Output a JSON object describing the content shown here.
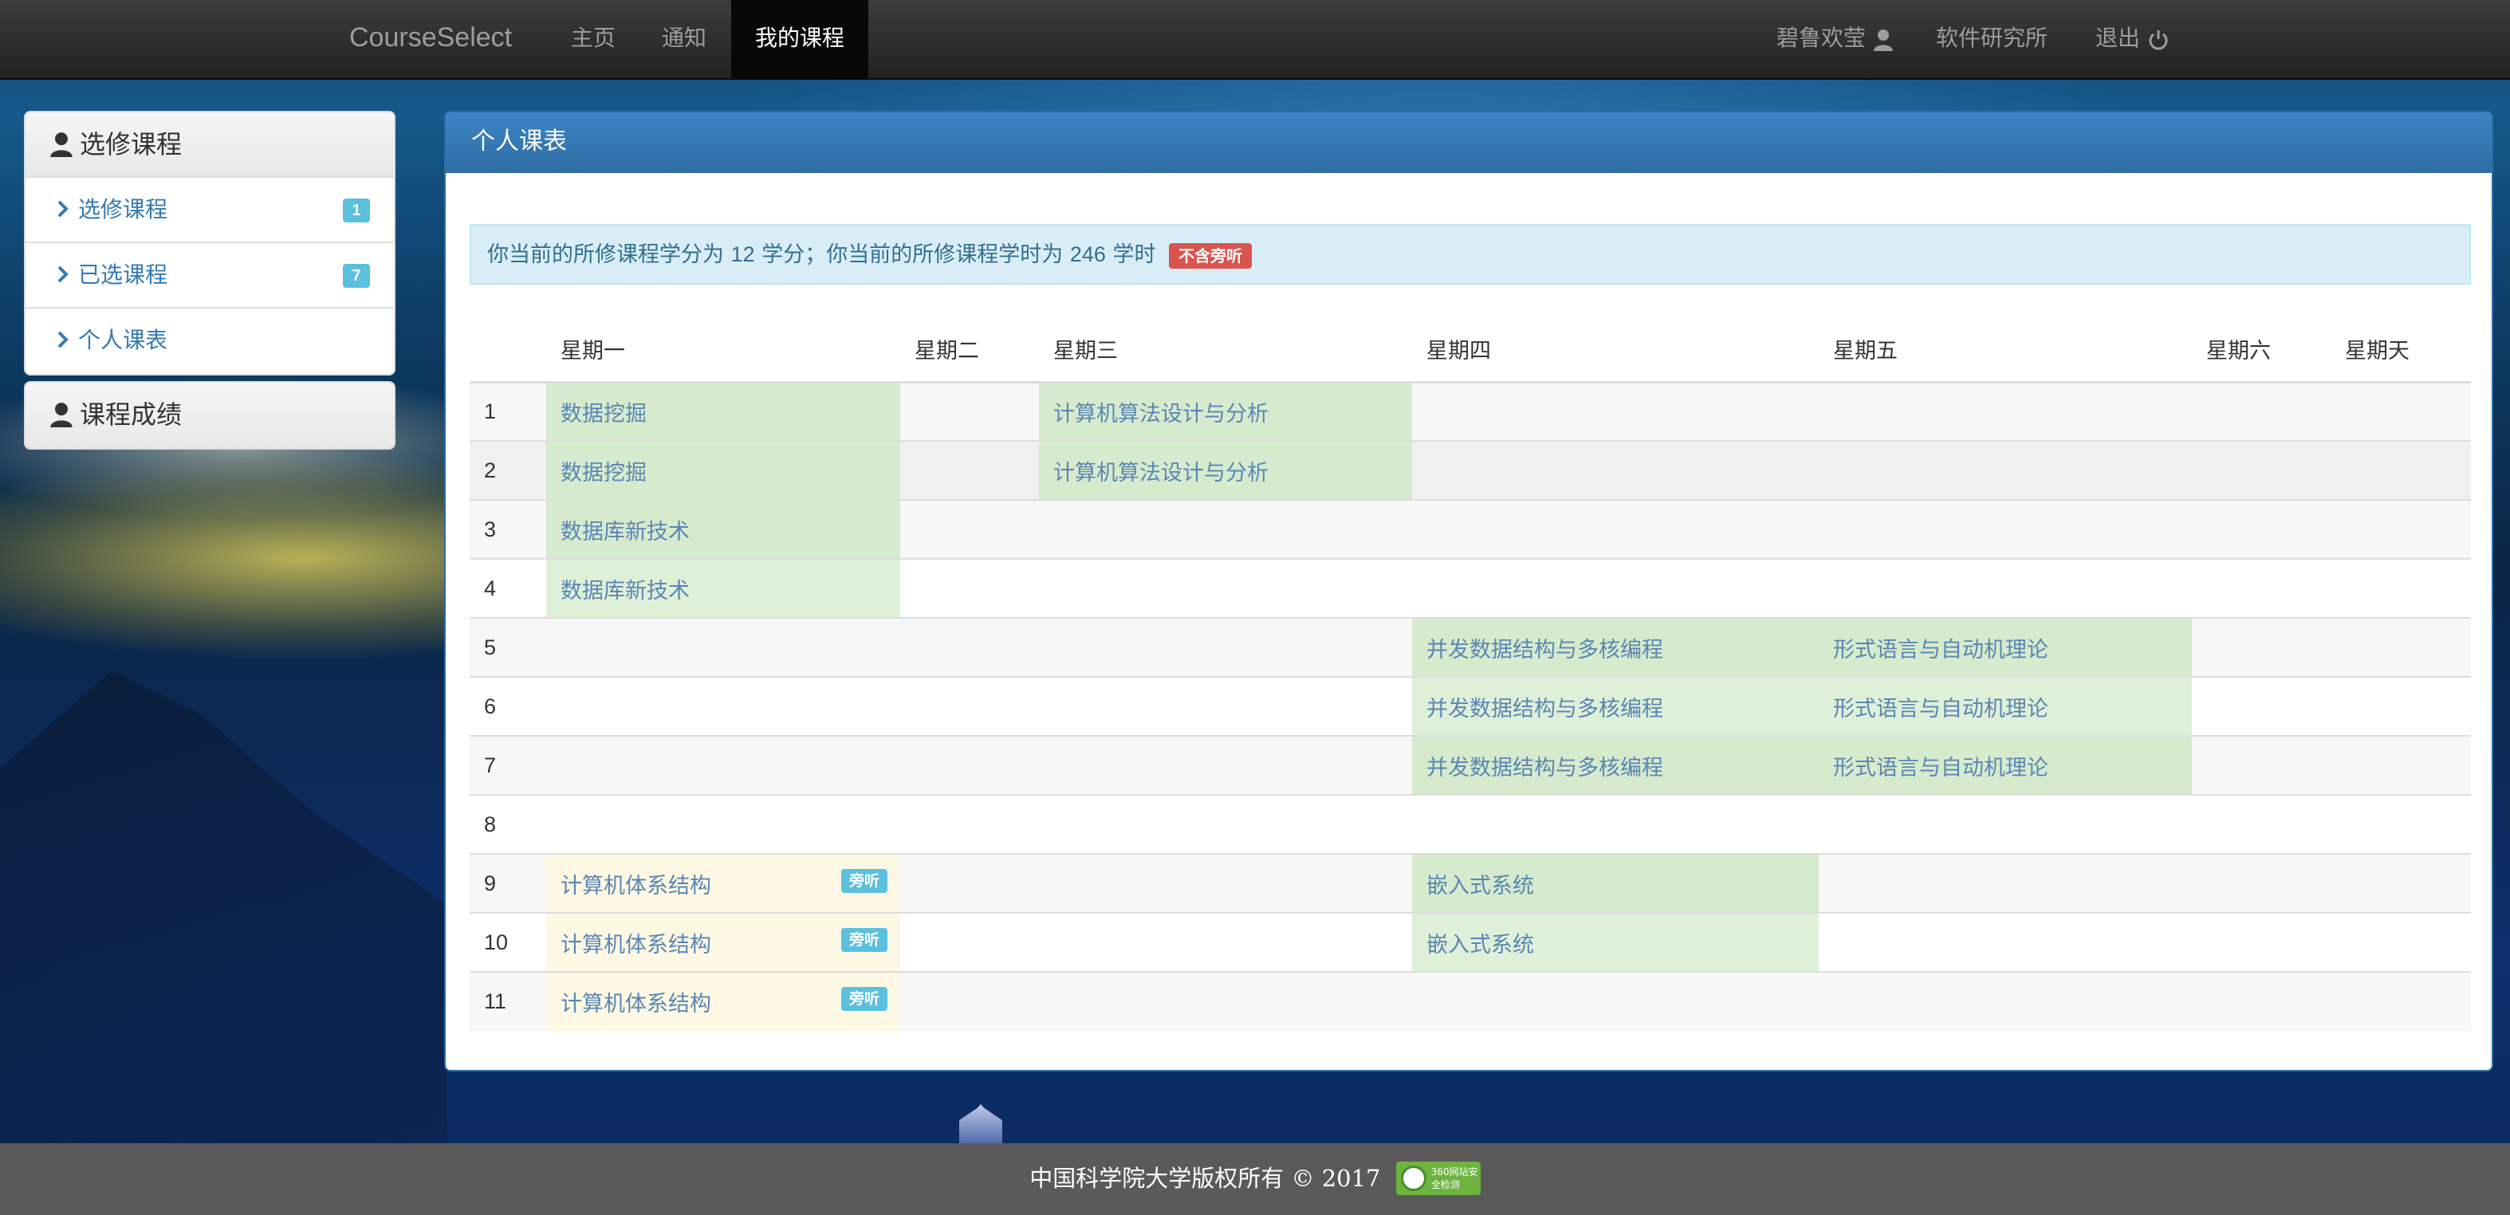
{
  "navbar": {
    "brand": "CourseSelect",
    "links": [
      "主页",
      "通知",
      "我的课程"
    ],
    "active_link": "我的课程",
    "user": "碧鲁欢莹",
    "dept": "软件研究所",
    "logout": "退出"
  },
  "sidebar": {
    "panel1_title": "选修课程",
    "items": [
      {
        "label": "选修课程",
        "badge": "1"
      },
      {
        "label": "已选课程",
        "badge": "7"
      },
      {
        "label": "个人课表",
        "badge": ""
      }
    ],
    "panel2_title": "课程成绩"
  },
  "main": {
    "title": "个人课表",
    "alert": {
      "prefix": "你当前的所修课程学分为",
      "credits": "12",
      "mid": "学分；你当前的所修课程学时为",
      "hours": "246",
      "suffix": "学时",
      "tag": "不含旁听"
    },
    "days": [
      "星期一",
      "星期二",
      "星期三",
      "星期四",
      "星期五",
      "星期六",
      "星期天"
    ],
    "audit_label": "旁听",
    "rows": [
      {
        "idx": "1",
        "mon": "数据挖掘",
        "wed": "计算机算法设计与分析"
      },
      {
        "idx": "2",
        "mon": "数据挖掘",
        "wed": "计算机算法设计与分析"
      },
      {
        "idx": "3",
        "mon": "数据库新技术"
      },
      {
        "idx": "4",
        "mon": "数据库新技术"
      },
      {
        "idx": "5",
        "thu": "并发数据结构与多核编程",
        "fri": "形式语言与自动机理论"
      },
      {
        "idx": "6",
        "thu": "并发数据结构与多核编程",
        "fri": "形式语言与自动机理论"
      },
      {
        "idx": "7",
        "thu": "并发数据结构与多核编程",
        "fri": "形式语言与自动机理论"
      },
      {
        "idx": "8"
      },
      {
        "idx": "9",
        "mon": "计算机体系结构",
        "thu": "嵌入式系统"
      },
      {
        "idx": "10",
        "mon": "计算机体系结构",
        "thu": "嵌入式系统"
      },
      {
        "idx": "11",
        "mon": "计算机体系结构"
      }
    ]
  },
  "footer": {
    "text": "中国科学院大学版权所有 © 2017",
    "seal_text": "360网站安全检测"
  },
  "colors": {
    "navbar": "#222222",
    "primary": "#2e6da4",
    "course_green": "#dff0d8",
    "audit_yellow": "#fcf8e3",
    "badge": "#5bc0de",
    "danger": "#d9534f"
  }
}
